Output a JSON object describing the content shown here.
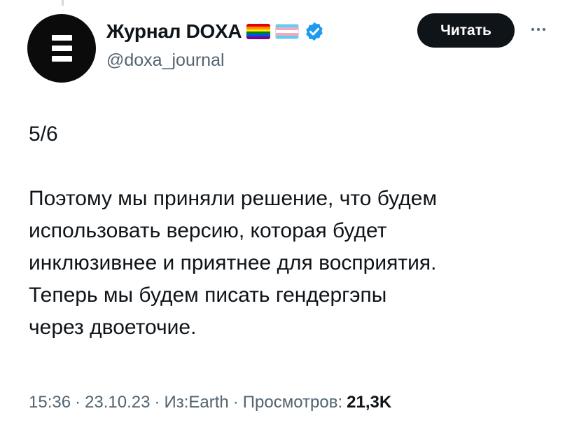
{
  "author": {
    "display_name": "Журнал DOXA",
    "handle": "@doxa_journal",
    "avatar_icon": "doxa-logo-icon",
    "badges": [
      "rainbow-flag-icon",
      "transgender-flag-icon",
      "verified-badge-icon"
    ],
    "verified_color": "#1d9bf0"
  },
  "actions": {
    "follow_label": "Читать",
    "more_icon": "more-icon"
  },
  "tweet": {
    "counter": "5/6",
    "body_lines": [
      "Поэтому мы приняли решение, что будем",
      "использовать версию, которая будет",
      "инклюзивнее и приятнее для восприятия.",
      "Теперь мы будем писать гендергэпы",
      "через двоеточие."
    ]
  },
  "meta": {
    "time": "15:36",
    "date": "23.10.23",
    "source": "Из:Earth",
    "views_label": "Просмотров:",
    "views_count": "21,3K",
    "separator": "·"
  }
}
